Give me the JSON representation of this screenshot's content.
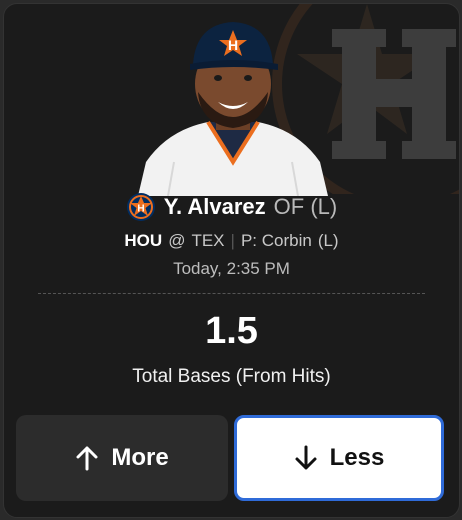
{
  "player": {
    "name": "Y. Alvarez",
    "position": "OF",
    "hand": "(L)",
    "team_logo_icon": "astros-logo-icon",
    "photo": "player-photo"
  },
  "matchup": {
    "team": "HOU",
    "at": "@",
    "opponent": "TEX",
    "separator": "|",
    "pitcher": "P: Corbin",
    "pitcher_hand": "(L)"
  },
  "game_time": "Today, 2:35 PM",
  "projection": {
    "line": "1.5",
    "stat": "Total Bases (From Hits)"
  },
  "actions": {
    "more_label": "More",
    "more_icon": "arrow-up-icon",
    "less_label": "Less",
    "less_icon": "arrow-down-icon"
  },
  "colors": {
    "card_bg": "#1b1b1b",
    "selected_border": "#2f6bd8",
    "astros_navy": "#002d62",
    "astros_orange": "#eb6e1f"
  }
}
